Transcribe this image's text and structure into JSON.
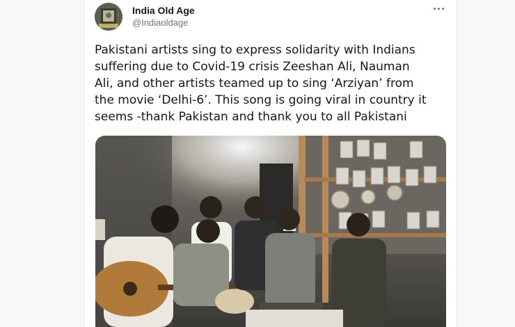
{
  "tweet": {
    "author": {
      "display_name": "India Old Age",
      "handle": "@Indiaoldage",
      "avatar_icon": "profile-avatar"
    },
    "more_icon": "more-options-icon",
    "text": "Pakistani artists sing to express solidarity with Indians\nsuffering due to Covid-19 crisis Zeeshan Ali, Nauman\nAli, and other artists teamed up to sing ‘Arziyan’ from\nthe movie ‘Delhi-6’. This song is going viral in country it\nseems -thank Pakistan and thank you to all Pakistani",
    "media": {
      "type": "video-frame"
    }
  },
  "colors": {
    "text_primary": "#14171a",
    "text_secondary": "#657786",
    "border": "#e6ecf0"
  }
}
